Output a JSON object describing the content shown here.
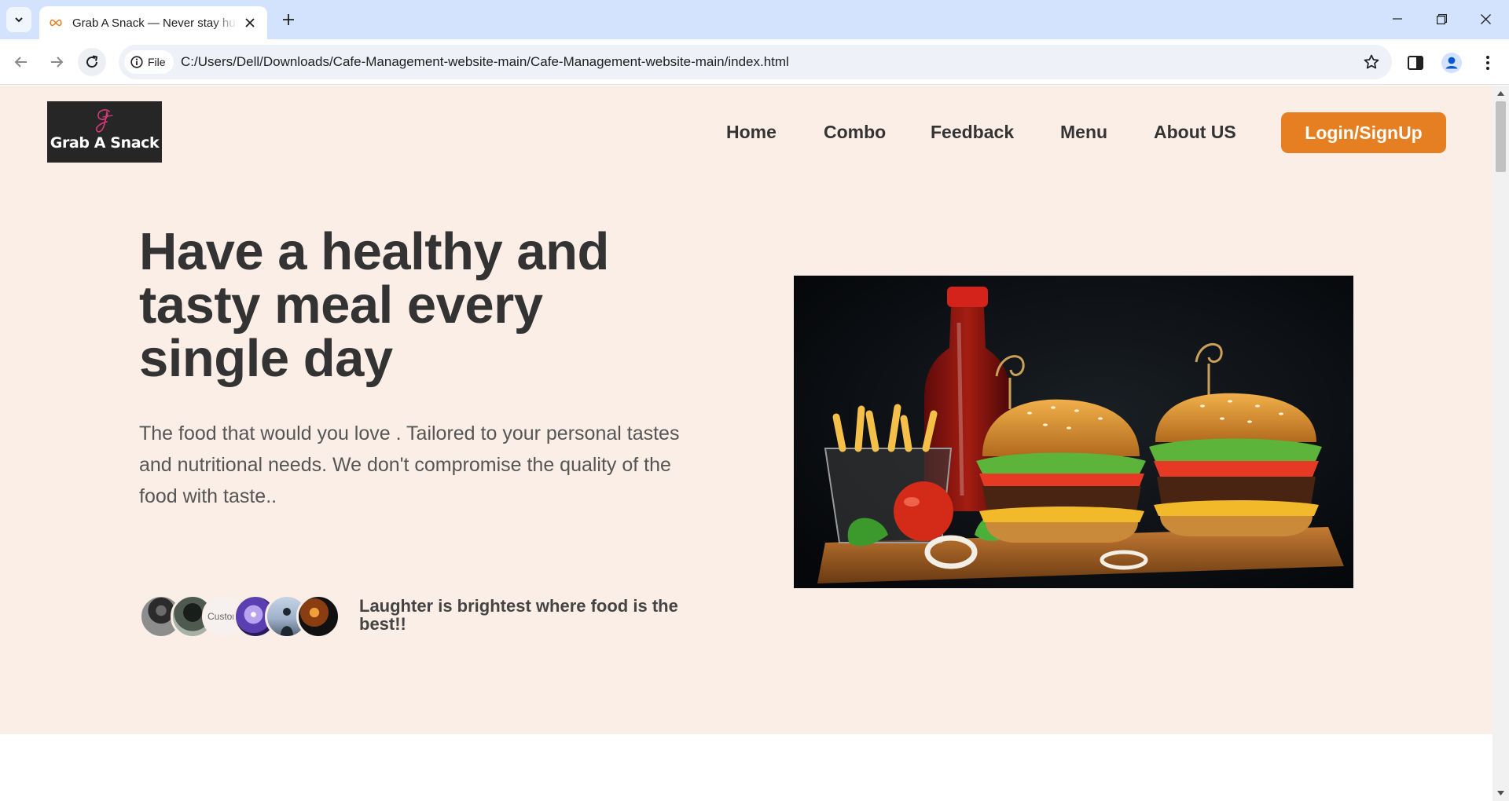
{
  "browser": {
    "tab_title": "Grab A Snack — Never stay hungry",
    "site_chip_label": "File",
    "url": "C:/Users/Dell/Downloads/Cafe-Management-website-main/Cafe-Management-website-main/index.html"
  },
  "site": {
    "logo_text": "Grab A Snack",
    "nav": [
      {
        "label": "Home"
      },
      {
        "label": "Combo"
      },
      {
        "label": "Feedback"
      },
      {
        "label": "Menu"
      },
      {
        "label": "About US"
      }
    ],
    "cta_label": "Login/SignUp"
  },
  "hero": {
    "headline": "Have a healthy and tasty meal every single day",
    "description": "The food that would you love . Tailored to your personal tastes and nutritional needs. We don't compromise the quality of the food with taste..",
    "broken_avatar_alt": "Customer photo",
    "avatars_caption": "Laughter is brightest where food is the best!!"
  },
  "colors": {
    "accent": "#e67e22",
    "hero_background": "#fbeee6",
    "heading_text": "#333333"
  }
}
